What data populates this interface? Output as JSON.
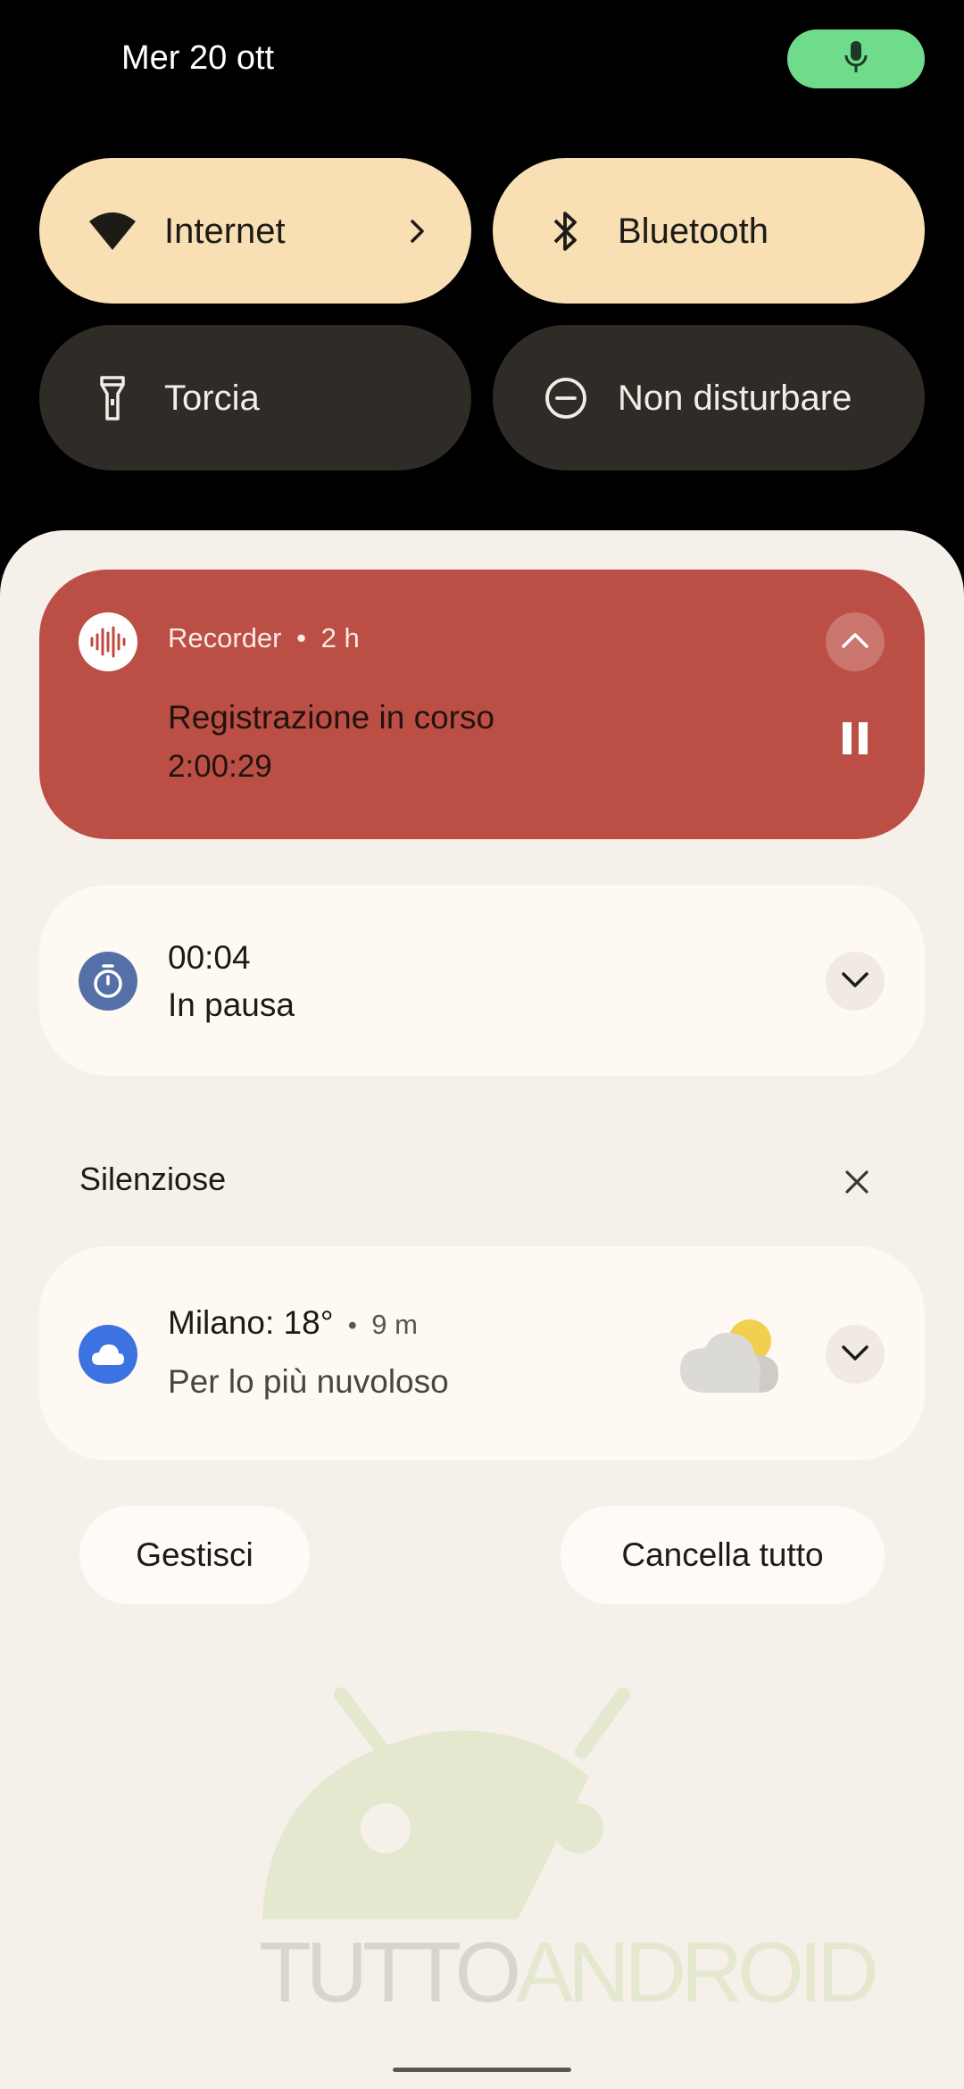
{
  "status": {
    "date": "Mer 20 ott",
    "mic_icon": "mic-icon",
    "mic_color": "#6fdc8c"
  },
  "quick_tiles": [
    {
      "label": "Internet",
      "icon": "wifi-icon",
      "active": true
    },
    {
      "label": "Bluetooth",
      "icon": "bluetooth-icon",
      "active": true
    },
    {
      "label": "Torcia",
      "icon": "flashlight-icon",
      "active": false
    },
    {
      "label": "Non disturbare",
      "icon": "do-not-disturb-icon",
      "active": false
    }
  ],
  "notifications": {
    "recorder": {
      "app": "Recorder",
      "separator": "•",
      "time": "2 h",
      "title": "Registrazione in corso",
      "elapsed": "2:00:29",
      "color": "#bc4f45"
    },
    "timer": {
      "time": "00:04",
      "status": "In pausa",
      "icon_color": "#5470a6"
    },
    "silent_header": "Silenziose",
    "weather": {
      "title": "Milano: 18°",
      "separator": "•",
      "time": "9 m",
      "text": "Per lo più nuvoloso",
      "icon_color": "#3d73e0"
    }
  },
  "actions": {
    "manage": "Gestisci",
    "clear_all": "Cancella tutto"
  },
  "watermark": {
    "part1": "TUTTO",
    "part2": "ANDROID"
  }
}
